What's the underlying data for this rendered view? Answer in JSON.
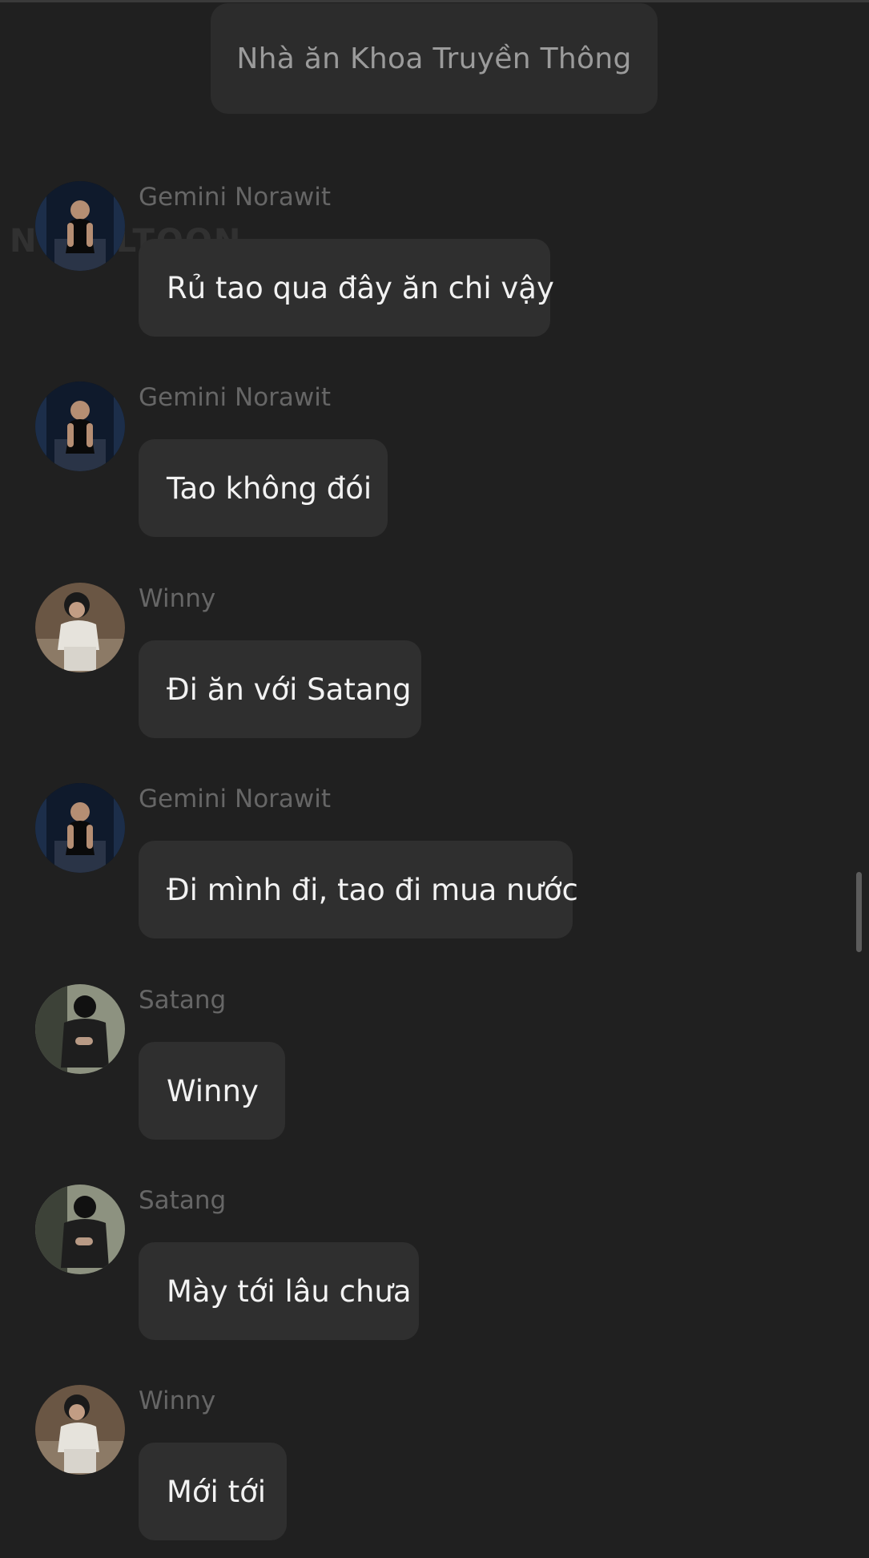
{
  "system_message": "Nhà ăn Khoa Truyền Thông",
  "watermark": "NOVELTOON",
  "messages": [
    {
      "sender": "Gemini Norawit",
      "text": "Rủ tao qua đây ăn chi vậy",
      "avatar": "gemini"
    },
    {
      "sender": "Gemini Norawit",
      "text": "Tao không đói",
      "avatar": "gemini"
    },
    {
      "sender": "Winny",
      "text": "Đi ăn với Satang",
      "avatar": "winny"
    },
    {
      "sender": "Gemini Norawit",
      "text": "Đi mình đi, tao đi mua nước",
      "avatar": "gemini"
    },
    {
      "sender": "Satang",
      "text": "Winny",
      "avatar": "satang"
    },
    {
      "sender": "Satang",
      "text": "Mày tới lâu chưa",
      "avatar": "satang"
    },
    {
      "sender": "Winny",
      "text": "Mới tới",
      "avatar": "winny"
    }
  ],
  "colors": {
    "background": "#202020",
    "bubble": "#2f2f2f",
    "system_bubble": "#2c2c2c",
    "sender_text": "#666666",
    "message_text": "#f2f2f2"
  }
}
